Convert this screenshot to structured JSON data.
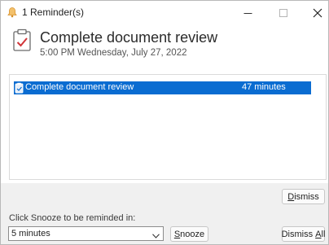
{
  "window": {
    "title": "1 Reminder(s)"
  },
  "header": {
    "subject": "Complete document review",
    "due_time": "5:00 PM Wednesday, July 27, 2022"
  },
  "reminders": [
    {
      "subject": "Complete document review",
      "due_in": "47 minutes",
      "selected": true
    }
  ],
  "buttons": {
    "dismiss_prefix": "",
    "dismiss_underlined": "D",
    "dismiss_suffix": "ismiss",
    "snooze_prefix": "",
    "snooze_underlined": "S",
    "snooze_suffix": "nooze",
    "dismiss_all_prefix": "Dismiss ",
    "dismiss_all_underlined": "A",
    "dismiss_all_suffix": "ll"
  },
  "snooze": {
    "label": "Click Snooze to be reminded in:",
    "selected_option": "5 minutes"
  },
  "colors": {
    "selection": "#0a6cd1",
    "bell": "#e8a63a",
    "check": "#d13438"
  }
}
